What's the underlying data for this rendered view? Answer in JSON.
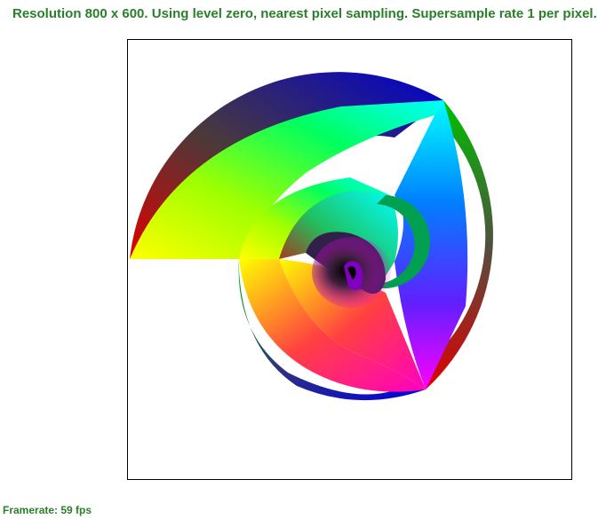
{
  "header": {
    "resolution_text": "Resolution 800 x 600. Using level zero, nearest pixel sampling. Supersample rate 1 per pixel."
  },
  "viewport": {
    "content": "spiral-render"
  },
  "footer": {
    "framerate_text": "Framerate: 59 fps"
  },
  "colors": {
    "text": "#2a7f2a",
    "frame_border": "#000000",
    "background": "#ffffff"
  }
}
